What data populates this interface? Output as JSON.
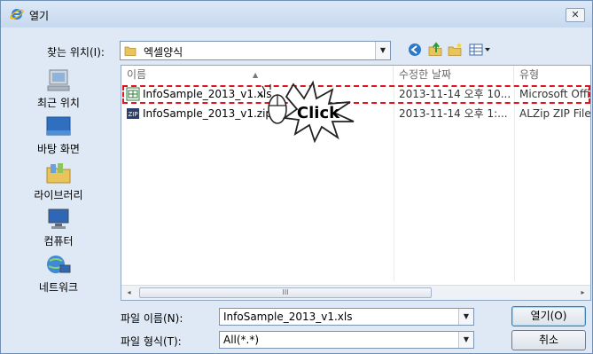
{
  "window": {
    "title": "열기",
    "close_label": "✕"
  },
  "lookin": {
    "label": "찾는 위치(I):",
    "value": "엑셀양식"
  },
  "toolbar": {
    "icons": [
      "back-icon",
      "up-folder-icon",
      "new-folder-icon",
      "view-menu-icon"
    ]
  },
  "places": [
    {
      "label": "최근 위치",
      "icon": "recent-places-icon"
    },
    {
      "label": "바탕 화면",
      "icon": "desktop-icon"
    },
    {
      "label": "라이브러리",
      "icon": "libraries-icon"
    },
    {
      "label": "컴퓨터",
      "icon": "computer-icon"
    },
    {
      "label": "네트워크",
      "icon": "network-icon"
    }
  ],
  "columns": {
    "name": "이름",
    "date": "수정한 날짜",
    "type": "유형"
  },
  "files": [
    {
      "name": "InfoSample_2013_v1.xls",
      "date": "2013-11-14 오후 10...",
      "type": "Microsoft Offic",
      "icon": "excel-file-icon"
    },
    {
      "name": "InfoSample_2013_v1.zip",
      "date": "2013-11-14 오후 1:...",
      "type": "ALZip ZIP File",
      "icon": "zip-file-icon"
    }
  ],
  "annotation": {
    "click_text": "Click"
  },
  "scrollbar": {
    "left_arrow": "◂",
    "right_arrow": "▸",
    "grip": "III"
  },
  "filename": {
    "label": "파일 이름(N):",
    "value": "InfoSample_2013_v1.xls"
  },
  "filetype": {
    "label": "파일 형식(T):",
    "value": "All(*.*)"
  },
  "buttons": {
    "open": "열기(O)",
    "cancel": "취소"
  },
  "colors": {
    "accent": "#e0141e",
    "window_bg": "#dfe9f5"
  }
}
